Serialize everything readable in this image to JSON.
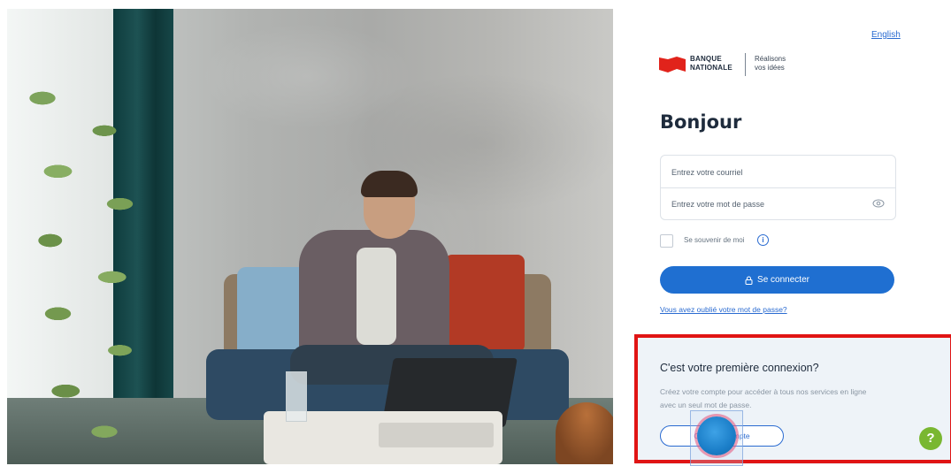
{
  "header": {
    "language_link": "English"
  },
  "brand": {
    "logo_line1": "BANQUE",
    "logo_line2": "NATIONALE",
    "tagline_line1": "Réalisons",
    "tagline_line2": "vos idées",
    "flag_color": "#e1231b"
  },
  "login": {
    "title": "Bonjour",
    "email_placeholder": "Entrez votre courriel",
    "password_placeholder": "Entrez votre mot de passe",
    "remember_label": "Se souvenir de moi",
    "info_icon": "i",
    "connect_label": "Se connecter",
    "forgot_link": "Vous avez oublié votre mot de passe?"
  },
  "first_connection": {
    "title": "C'est votre première connexion?",
    "description": "Créez votre compte pour accéder à tous nos services en ligne avec un seul mot de passe.",
    "create_label": "Créer un compte"
  },
  "help": {
    "label": "?"
  },
  "colors": {
    "primary": "#1f6fd1",
    "highlight": "#e01414",
    "help": "#79b731"
  },
  "icons": [
    "eye-icon",
    "lock-icon",
    "info-icon",
    "help-icon",
    "flag-icon"
  ]
}
